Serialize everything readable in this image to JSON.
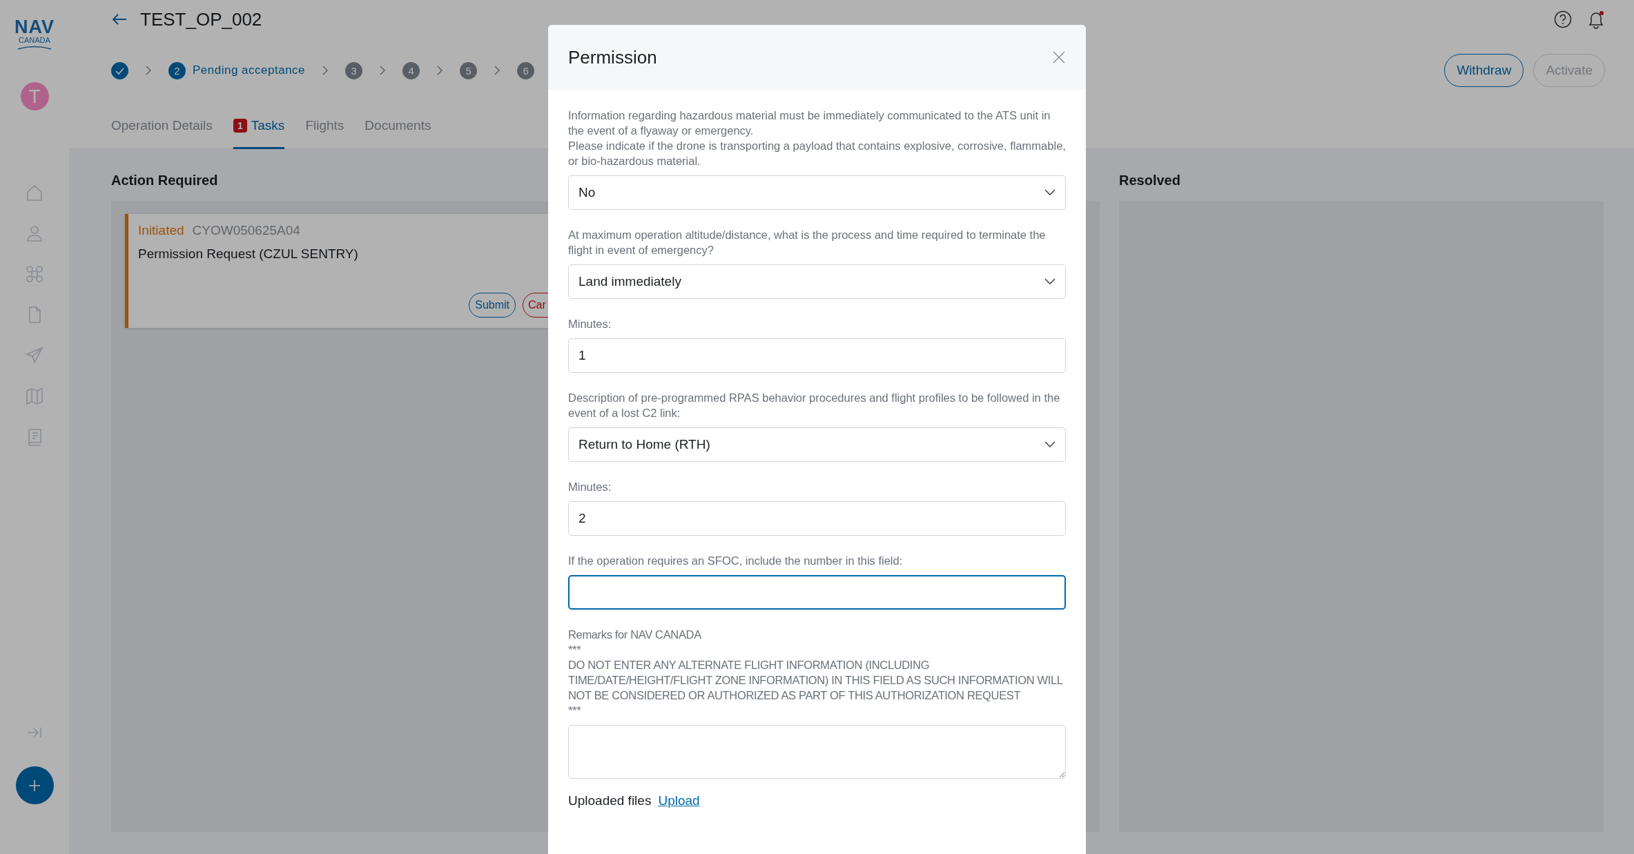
{
  "sidebar": {
    "logo": {
      "wordmark": "NAV",
      "subtitle": "CANADA"
    },
    "avatar_initial": "T"
  },
  "header": {
    "title": "TEST_OP_002",
    "actions": [
      {
        "label": "Withdraw",
        "disabled": false
      },
      {
        "label": "Activate",
        "disabled": true
      }
    ]
  },
  "stepper": [
    {
      "kind": "done"
    },
    {
      "kind": "current",
      "number": "2",
      "label": "Pending acceptance"
    },
    {
      "kind": "upcoming",
      "number": "3"
    },
    {
      "kind": "upcoming",
      "number": "4"
    },
    {
      "kind": "upcoming",
      "number": "5"
    },
    {
      "kind": "upcoming",
      "number": "6"
    }
  ],
  "tabs": [
    {
      "label": "Operation Details",
      "selected": false
    },
    {
      "label": "Tasks",
      "badge": "1",
      "selected": true
    },
    {
      "label": "Flights",
      "selected": false
    },
    {
      "label": "Documents",
      "selected": false
    }
  ],
  "board": {
    "columns": [
      {
        "title": "Action Required",
        "cards": [
          {
            "status": "Initiated",
            "code": "CYOW050625A04",
            "title": "Permission Request (CZUL SENTRY)",
            "buttons": [
              {
                "label": "Submit",
                "kind": "primary"
              },
              {
                "label": "Car",
                "kind": "danger"
              }
            ]
          }
        ]
      },
      {
        "title": "Resolved"
      }
    ]
  },
  "modal": {
    "title": "Permission",
    "fields": [
      {
        "kind": "select",
        "label": "Information regarding hazardous material must be immediately communicated to the ATS unit in the event of a flyaway or emergency.\nPlease indicate if the drone is transporting a payload that contains explosive, corrosive, flammable, or bio-hazardous material.",
        "value": "No"
      },
      {
        "kind": "select",
        "label": "At maximum operation altitude/distance, what is the process and time required to terminate the flight in event of emergency?",
        "value": "Land immediately"
      },
      {
        "kind": "text",
        "label": "Minutes:",
        "value": "1",
        "focused": false
      },
      {
        "kind": "select",
        "label": "Description of pre-programmed RPAS behavior procedures and flight profiles to be followed in the event of a lost C2 link:",
        "value": "Return to Home (RTH)"
      },
      {
        "kind": "text",
        "label": "Minutes:",
        "value": "2",
        "focused": false
      },
      {
        "kind": "text",
        "label": "If the operation requires an SFOC, include the number in this field:",
        "focused": true
      },
      {
        "kind": "textarea",
        "label": "Remarks for NAV CANADA\n***\nDO NOT ENTER ANY ALTERNATE FLIGHT INFORMATION (INCLUDING TIME/DATE/HEIGHT/FLIGHT ZONE INFORMATION) IN THIS FIELD AS SUCH INFORMATION WILL NOT BE CONSIDERED OR AUTHORIZED AS PART OF THIS AUTHORIZATION REQUEST\n***"
      }
    ],
    "uploads": {
      "label": "Uploaded files",
      "link": "Upload"
    }
  }
}
